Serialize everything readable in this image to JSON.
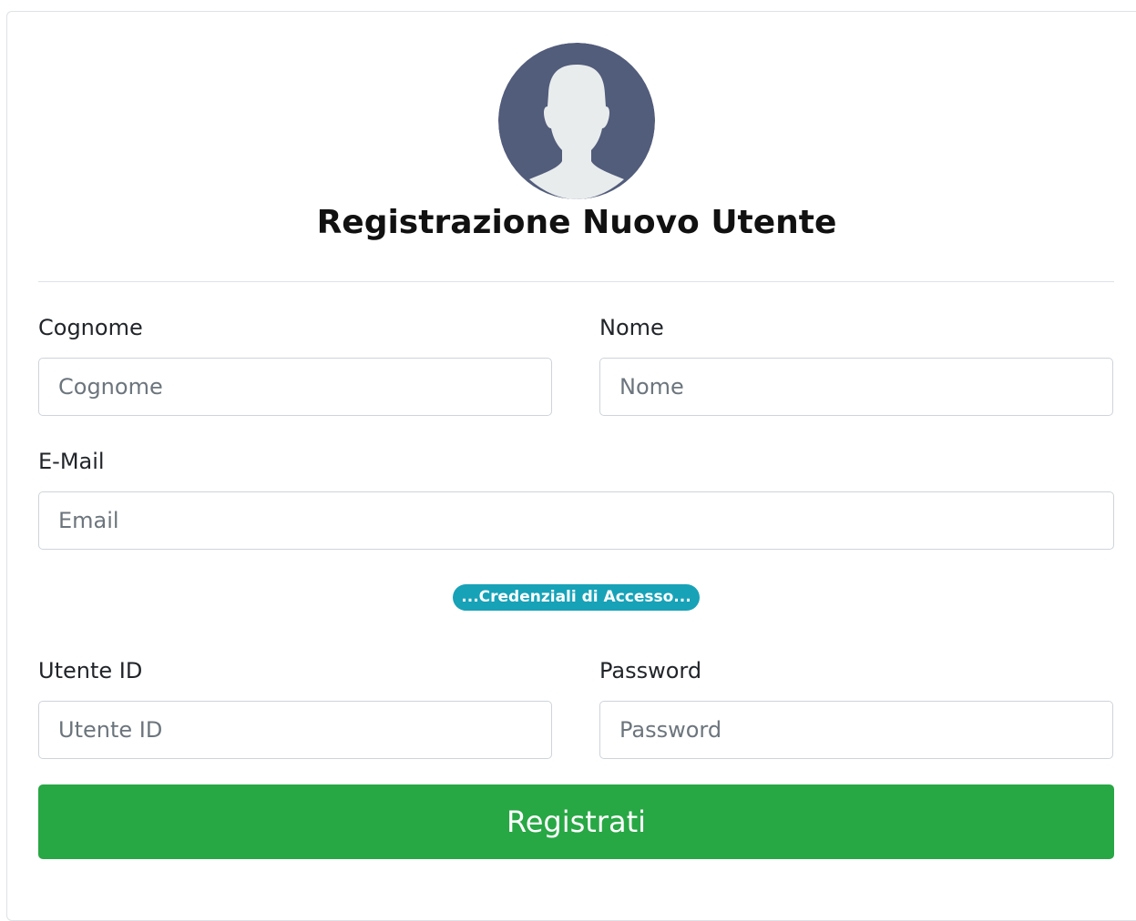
{
  "form": {
    "title": "Registrazione Nuovo Utente",
    "avatar_icon": "user-silhouette-icon",
    "colors": {
      "avatar_bg": "#525c7b",
      "avatar_figure": "#e8ecec",
      "badge": "#17a2b8",
      "submit": "#28a745"
    },
    "fields": {
      "cognome": {
        "label": "Cognome",
        "placeholder": "Cognome",
        "value": ""
      },
      "nome": {
        "label": "Nome",
        "placeholder": "Nome",
        "value": ""
      },
      "email": {
        "label": "E-Mail",
        "placeholder": "Email",
        "value": ""
      },
      "utente_id": {
        "label": "Utente ID",
        "placeholder": "Utente ID",
        "value": ""
      },
      "password": {
        "label": "Password",
        "placeholder": "Password",
        "value": ""
      }
    },
    "section_badge": "...Credenziali di Accesso...",
    "submit_label": "Registrati"
  }
}
